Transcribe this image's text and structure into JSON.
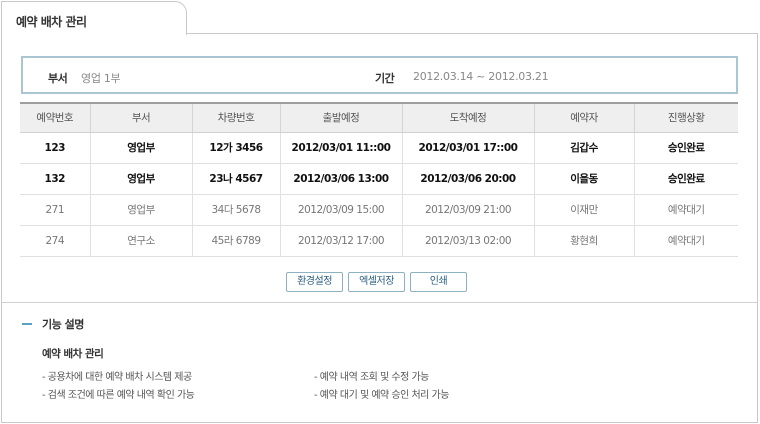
{
  "tab": {
    "title": "예약 배차 관리"
  },
  "filter": {
    "dept_label": "부서",
    "dept_value": "영업 1부",
    "period_label": "기간",
    "period_value": "2012.03.14 ~ 2012.03.21"
  },
  "table": {
    "headers": [
      "예약번호",
      "부서",
      "차량번호",
      "출발예정",
      "도착예정",
      "예약자",
      "진행상황"
    ],
    "rows": [
      [
        "123",
        "영업부",
        "12가 3456",
        "2012/03/01 11::00",
        "2012/03/01 17::00",
        "김갑수",
        "승인완료"
      ],
      [
        "132",
        "영업부",
        "23나 4567",
        "2012/03/06 13:00",
        "2012/03/06 20:00",
        "이을동",
        "승인완료"
      ],
      [
        "271",
        "영업부",
        "34다 5678",
        "2012/03/09 15:00",
        "2012/03/09 21:00",
        "이재만",
        "예약대기"
      ],
      [
        "274",
        "연구소",
        "45라 6789",
        "2012/03/12 17:00",
        "2012/03/13 02:00",
        "황현희",
        "예약대기"
      ]
    ]
  },
  "buttons": {
    "settings": "환경설정",
    "excel": "엑셀저장",
    "print": "인쇄"
  },
  "info": {
    "heading": "기능 설명",
    "title": "예약 배차 관리",
    "items": [
      "- 공용차에 대한 예약 배차 시스템 제공",
      "- 예약 내역 조회 및 수정 가능",
      "- 검색 조건에 따른 예약 내역 확인 가능",
      "- 예약 대기 및 예약 승인 처리 가능"
    ]
  }
}
